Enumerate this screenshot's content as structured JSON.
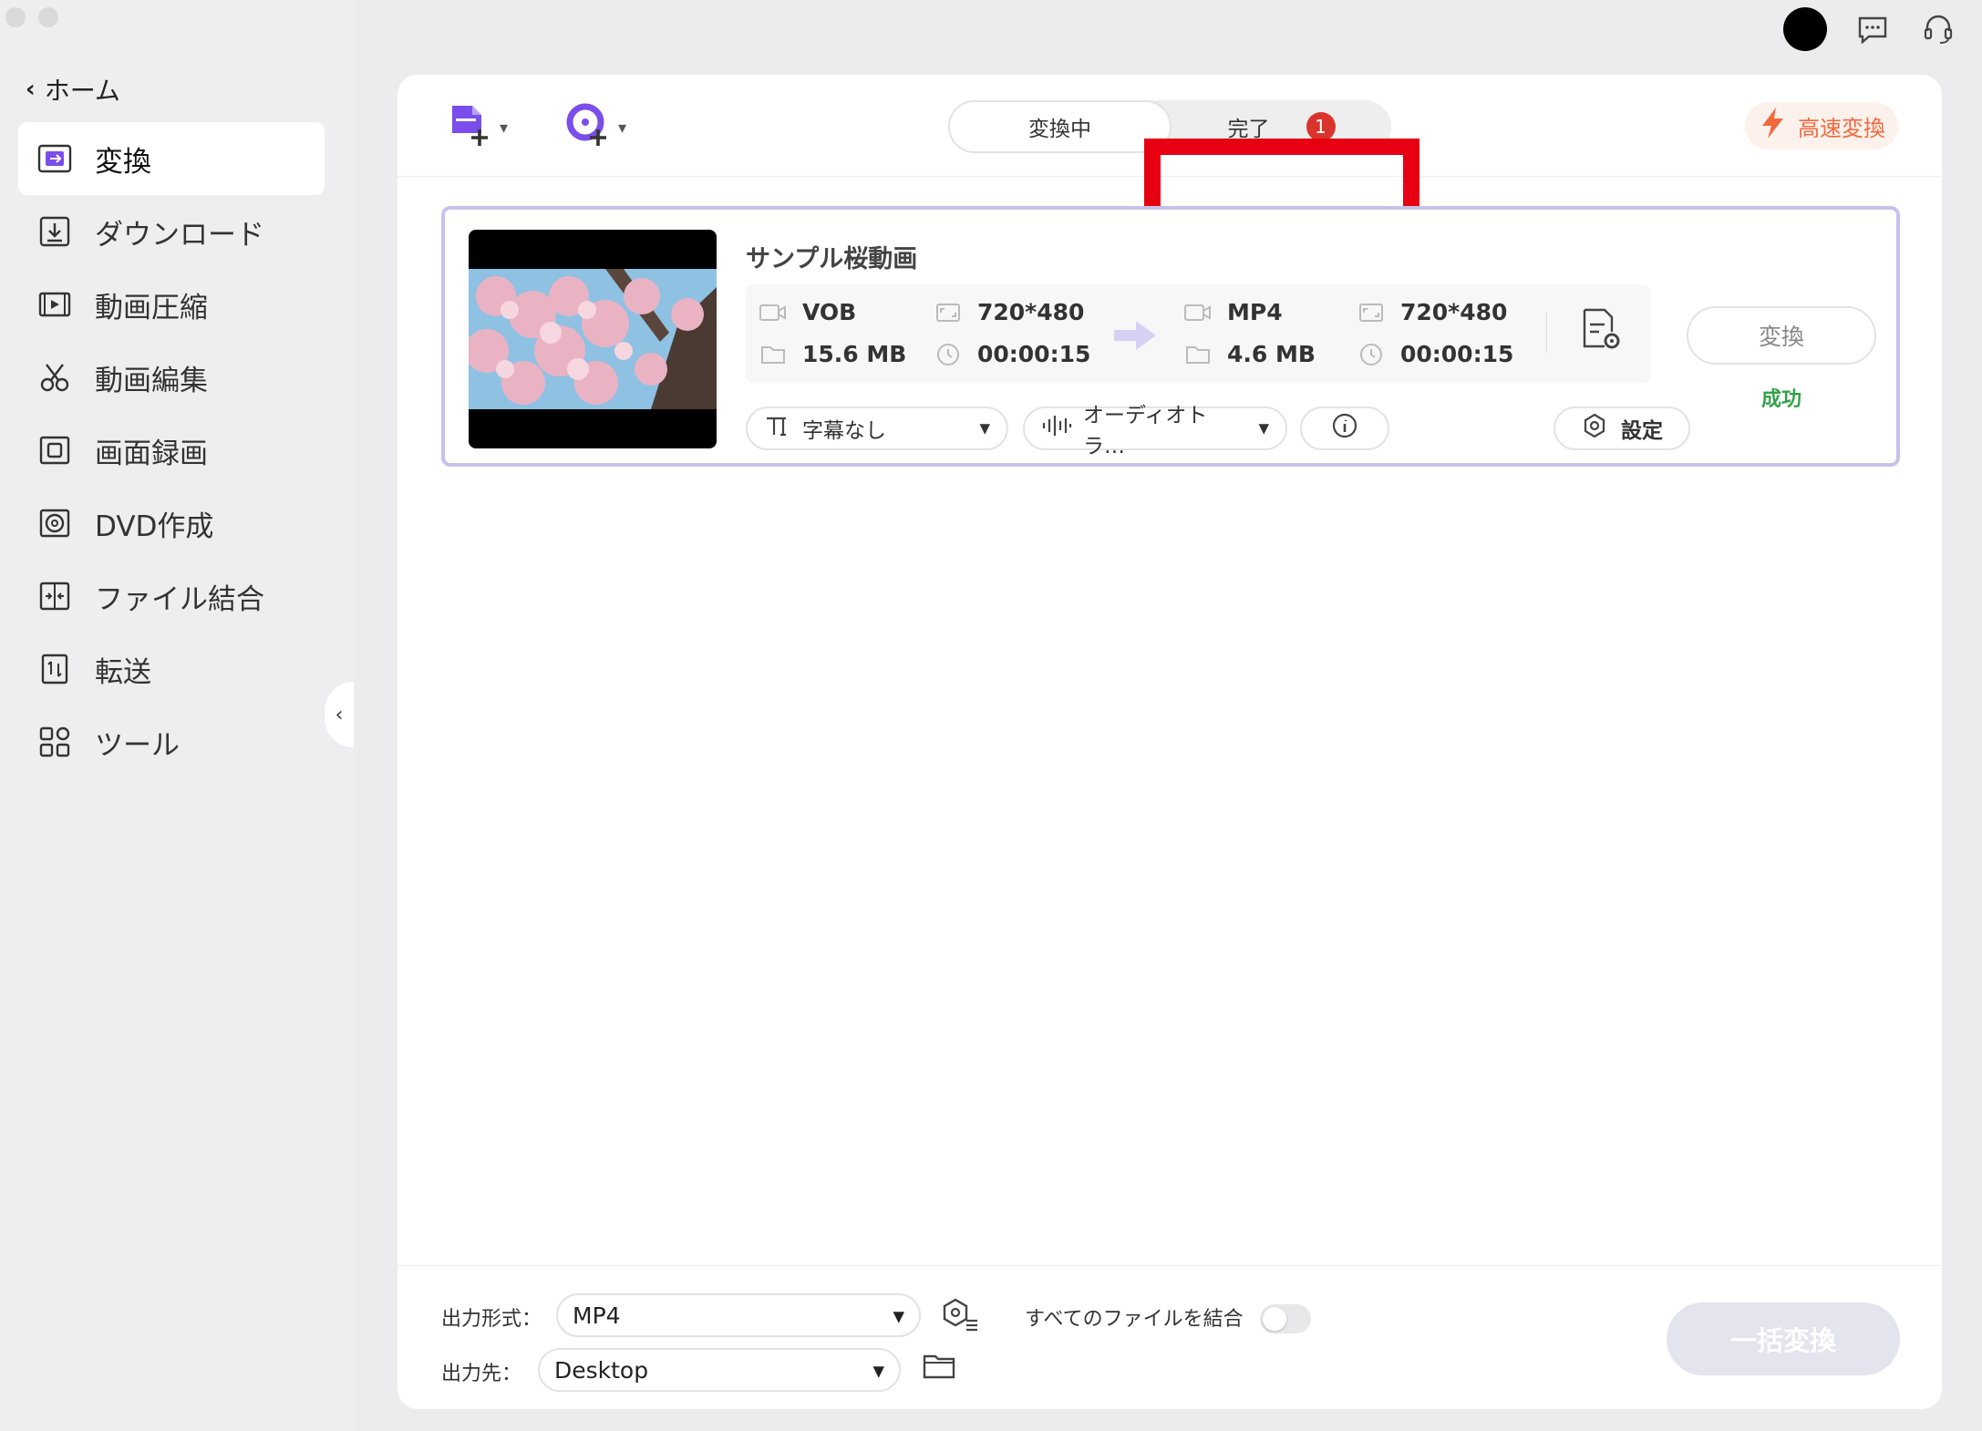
{
  "sidebar": {
    "back_label": "ホーム",
    "items": [
      {
        "label": "変換",
        "icon": "convert-icon",
        "active": true
      },
      {
        "label": "ダウンロード",
        "icon": "download-icon"
      },
      {
        "label": "動画圧縮",
        "icon": "compress-icon"
      },
      {
        "label": "動画編集",
        "icon": "scissors-icon"
      },
      {
        "label": "画面録画",
        "icon": "screen-record-icon"
      },
      {
        "label": "DVD作成",
        "icon": "dvd-icon"
      },
      {
        "label": "ファイル結合",
        "icon": "merge-icon"
      },
      {
        "label": "転送",
        "icon": "transfer-icon"
      },
      {
        "label": "ツール",
        "icon": "tools-icon"
      }
    ]
  },
  "header": {
    "tabs": [
      {
        "label": "変換中",
        "active": true
      },
      {
        "label": "完了",
        "badge": "1"
      }
    ],
    "fast_convert_label": "高速変換"
  },
  "file": {
    "title": "サンプル桜動画",
    "source": {
      "format": "VOB",
      "resolution": "720*480",
      "size": "15.6 MB",
      "duration": "00:00:15"
    },
    "target": {
      "format": "MP4",
      "resolution": "720*480",
      "size": "4.6 MB",
      "duration": "00:00:15"
    },
    "subtitle": "字幕なし",
    "audio": "オーディオトラ…",
    "settings_label": "設定",
    "convert_label": "変換",
    "status": "成功"
  },
  "bottom": {
    "format_label": "出力形式：",
    "format_value": "MP4",
    "dest_label": "出力先：",
    "dest_value": "Desktop",
    "merge_label": "すべてのファイルを結合",
    "batch_label": "一括変換"
  },
  "colors": {
    "accent": "#7b4dea",
    "highlight": "#e60012",
    "success": "#33a24a",
    "fast": "#f06a3e"
  }
}
